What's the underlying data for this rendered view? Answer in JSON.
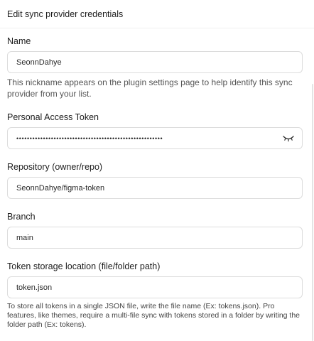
{
  "header": {
    "title": "Edit sync provider credentials"
  },
  "name": {
    "label": "Name",
    "value": "SeonnDahye",
    "help": "This nickname appears on the plugin settings page to help identify this sync provider from your list."
  },
  "token": {
    "label": "Personal Access Token",
    "masked_value": "•••••••••••••••••••••••••••••••••••••••••••••••••••••••",
    "toggle_icon": "eye-closed-icon"
  },
  "repository": {
    "label": "Repository (owner/repo)",
    "value": "SeonnDahye/figma-token"
  },
  "branch": {
    "label": "Branch",
    "value": "main"
  },
  "storage": {
    "label": "Token storage location (file/folder path)",
    "value": "token.json",
    "help": "To store all tokens in a single JSON file, write the file name (Ex: tokens.json). Pro features, like themes, require a multi-file sync with tokens stored in a folder by writing the folder path (Ex: tokens)."
  }
}
